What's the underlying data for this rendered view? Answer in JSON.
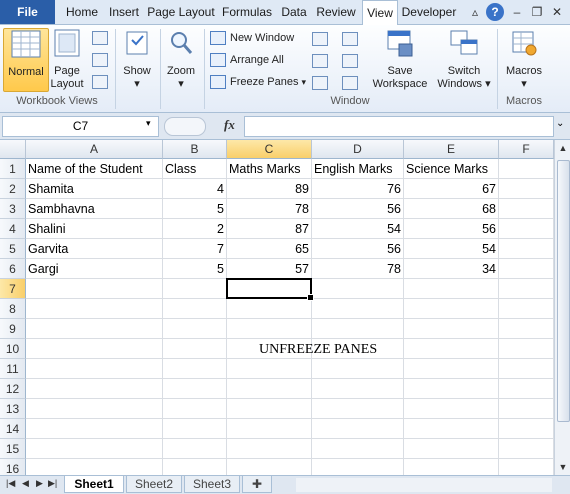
{
  "ribbon_tabs": {
    "file": "File",
    "tabs": [
      "Home",
      "Insert",
      "Page Layout",
      "Formulas",
      "Data",
      "Review",
      "View",
      "Developer"
    ],
    "active": "View"
  },
  "window_controls": {
    "help": "?",
    "minimize": "–",
    "restore": "❐",
    "close": "✕"
  },
  "groups": {
    "workbook_views": {
      "label": "Workbook Views",
      "normal": "Normal",
      "page_layout_line1": "Page",
      "page_layout_line2": "Layout"
    },
    "show": {
      "label": "Show"
    },
    "zoom": {
      "label": "Zoom"
    },
    "window": {
      "label": "Window",
      "new_window": "New Window",
      "arrange_all": "Arrange All",
      "freeze_panes": "Freeze Panes",
      "save_workspace_line1": "Save",
      "save_workspace_line2": "Workspace",
      "switch_windows_line1": "Switch",
      "switch_windows_line2": "Windows"
    },
    "macros": {
      "label": "Macros",
      "button": "Macros"
    }
  },
  "formula_bar": {
    "name_box": "C7",
    "fx": "fx",
    "value": ""
  },
  "columns": [
    "A",
    "B",
    "C",
    "D",
    "E",
    "F"
  ],
  "selected_column": "C",
  "selected_row": 7,
  "rows": [
    "1",
    "2",
    "3",
    "4",
    "5",
    "6",
    "7",
    "8",
    "9",
    "10",
    "11",
    "12",
    "13",
    "14",
    "15",
    "16"
  ],
  "headers": [
    "Name of the Student",
    "Class",
    "Maths Marks",
    "English Marks",
    "Science Marks"
  ],
  "data_rows": [
    [
      "Shamita",
      "4",
      "89",
      "76",
      "67"
    ],
    [
      "Sambhavna",
      "5",
      "78",
      "56",
      "68"
    ],
    [
      "Shalini",
      "2",
      "87",
      "54",
      "56"
    ],
    [
      "Garvita",
      "7",
      "65",
      "56",
      "54"
    ],
    [
      "Gargi",
      "5",
      "57",
      "78",
      "34"
    ]
  ],
  "annotation": "UNFREEZE PANES",
  "sheets": [
    "Sheet1",
    "Sheet2",
    "Sheet3"
  ],
  "active_sheet": "Sheet1"
}
